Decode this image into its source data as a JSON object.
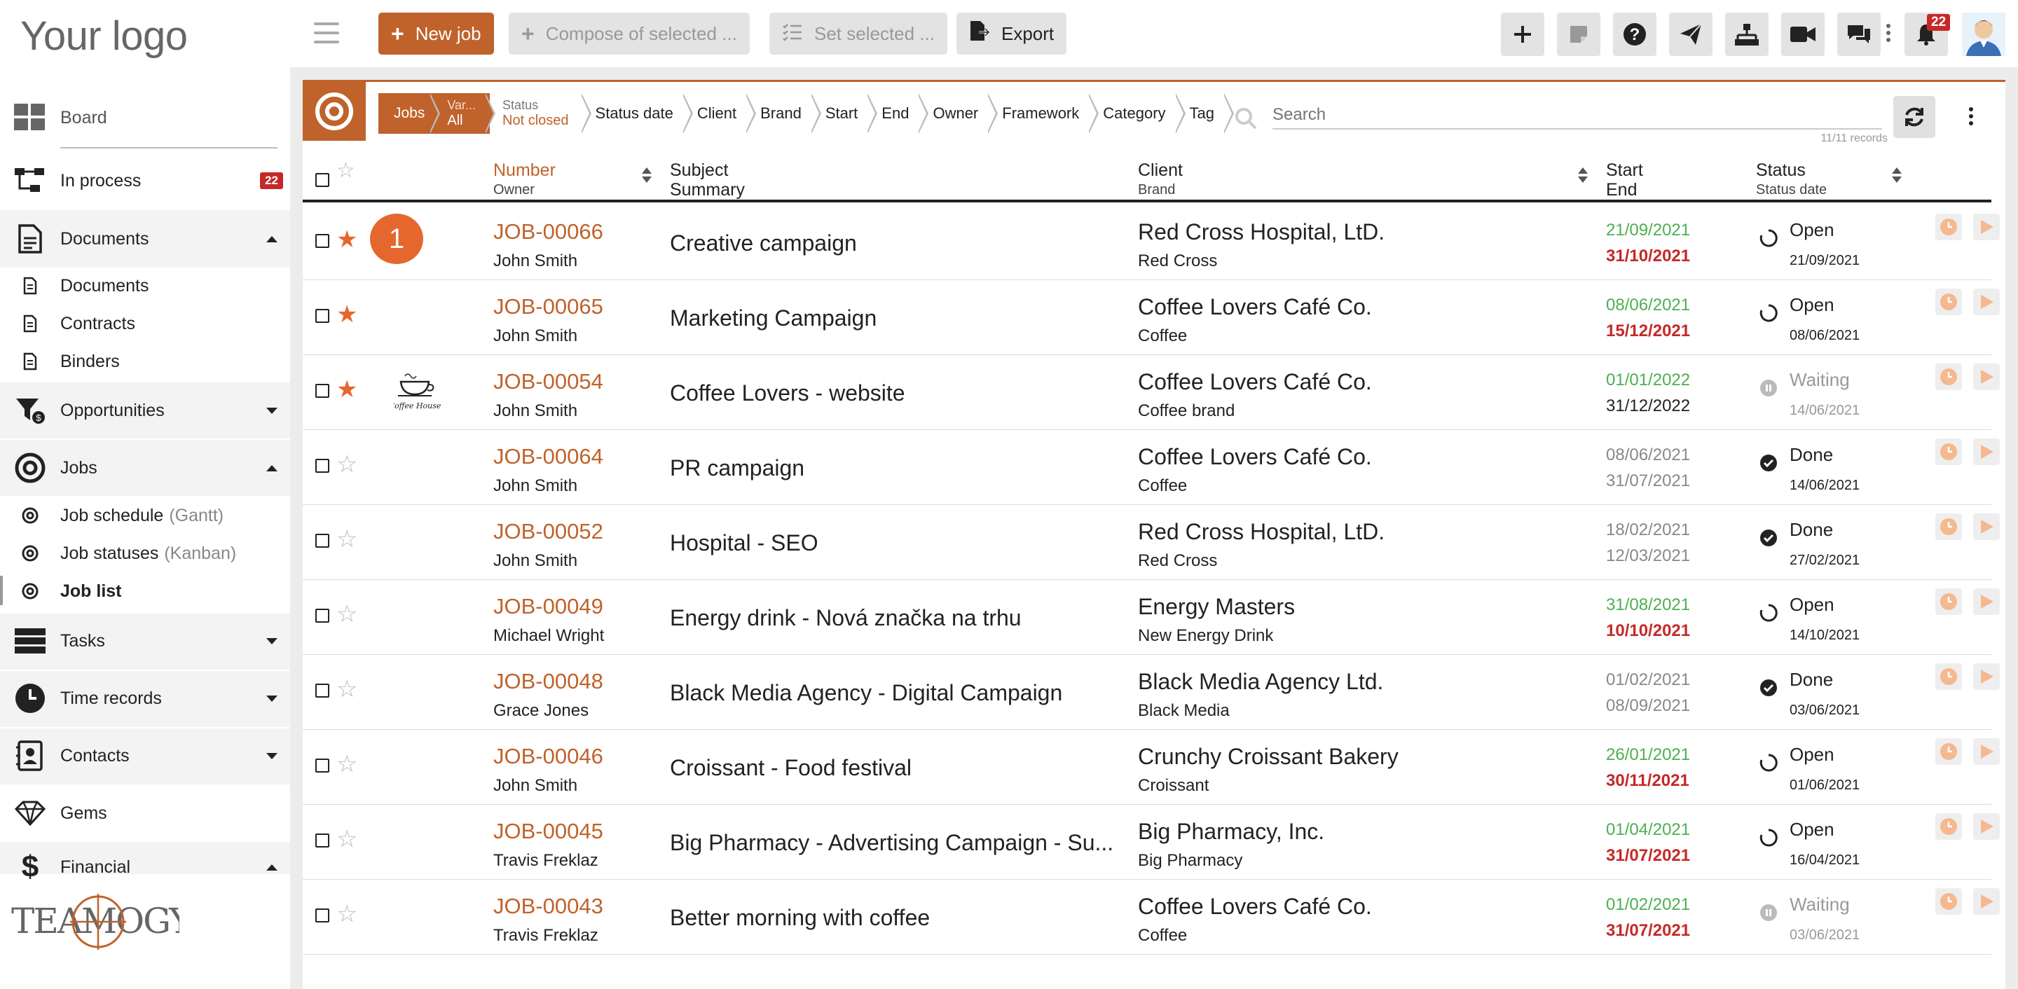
{
  "app": {
    "logo_text": "Your logo"
  },
  "sidebar": {
    "board": "Board",
    "in_process": "In process",
    "in_process_badge": "22",
    "documents": "Documents",
    "documents_items": [
      "Documents",
      "Contracts",
      "Binders"
    ],
    "opportunities": "Opportunities",
    "jobs": "Jobs",
    "jobs_items": [
      {
        "label": "Job schedule",
        "hint": "(Gantt)"
      },
      {
        "label": "Job statuses",
        "hint": "(Kanban)"
      },
      {
        "label": "Job list",
        "hint": ""
      }
    ],
    "tasks": "Tasks",
    "time_records": "Time records",
    "contacts": "Contacts",
    "gems": "Gems",
    "financial": "Financial",
    "brand_logo": "TEAMOGY"
  },
  "toolbar": {
    "new_job": "New job",
    "compose": "Compose of selected ...",
    "set_selected": "Set selected ...",
    "export": "Export",
    "notifications_badge": "22"
  },
  "filters": {
    "tab_jobs": "Jobs",
    "var_label": "Var...",
    "var_value": "All",
    "status_label": "Status",
    "status_value": "Not closed",
    "crumbs": [
      "Status date",
      "Client",
      "Brand",
      "Start",
      "End",
      "Owner",
      "Framework",
      "Category",
      "Tag"
    ],
    "search_placeholder": "Search",
    "records": "11/11 records"
  },
  "table": {
    "headers": {
      "number": "Number",
      "owner": "Owner",
      "subject": "Subject",
      "summary": "Summary",
      "client": "Client",
      "brand": "Brand",
      "start": "Start",
      "end": "End",
      "status": "Status",
      "status_date": "Status date"
    },
    "rows": [
      {
        "number": "JOB-00066",
        "owner": "John Smith",
        "subject": "Creative campaign",
        "client": "Red Cross Hospital, LtD.",
        "brand": "Red Cross",
        "start": "21/09/2021",
        "end": "31/10/2021",
        "status": "Open",
        "status_date": "21/09/2021",
        "starred": true,
        "badge": "1"
      },
      {
        "number": "JOB-00065",
        "owner": "John Smith",
        "subject": "Marketing Campaign",
        "client": "Coffee Lovers Café Co.",
        "brand": "Coffee",
        "start": "08/06/2021",
        "end": "15/12/2021",
        "status": "Open",
        "status_date": "08/06/2021",
        "starred": true
      },
      {
        "number": "JOB-00054",
        "owner": "John Smith",
        "subject": "Coffee Lovers - website",
        "client": "Coffee Lovers Café Co.",
        "brand": "Coffee brand",
        "start": "01/01/2022",
        "end": "31/12/2022",
        "status": "Waiting",
        "status_date": "14/06/2021",
        "starred": true,
        "image_text": "Coffee House"
      },
      {
        "number": "JOB-00064",
        "owner": "John Smith",
        "subject": "PR campaign",
        "client": "Coffee Lovers Café Co.",
        "brand": "Coffee",
        "start": "08/06/2021",
        "end": "31/07/2021",
        "status": "Done",
        "status_date": "14/06/2021",
        "starred": false
      },
      {
        "number": "JOB-00052",
        "owner": "John Smith",
        "subject": "Hospital - SEO",
        "client": "Red Cross Hospital, LtD.",
        "brand": "Red Cross",
        "start": "18/02/2021",
        "end": "12/03/2021",
        "status": "Done",
        "status_date": "27/02/2021",
        "starred": false
      },
      {
        "number": "JOB-00049",
        "owner": "Michael Wright",
        "subject": "Energy drink - Nová značka na trhu",
        "client": "Energy Masters",
        "brand": "New Energy Drink",
        "start": "31/08/2021",
        "end": "10/10/2021",
        "status": "Open",
        "status_date": "14/10/2021",
        "starred": false
      },
      {
        "number": "JOB-00048",
        "owner": "Grace Jones",
        "subject": "Black Media Agency - Digital Campaign",
        "client": "Black Media Agency Ltd.",
        "brand": "Black Media",
        "start": "01/02/2021",
        "end": "08/09/2021",
        "status": "Done",
        "status_date": "03/06/2021",
        "starred": false
      },
      {
        "number": "JOB-00046",
        "owner": "John Smith",
        "subject": "Croissant - Food festival",
        "client": "Crunchy Croissant Bakery",
        "brand": "Croissant",
        "start": "26/01/2021",
        "end": "30/11/2021",
        "status": "Open",
        "status_date": "01/06/2021",
        "starred": false
      },
      {
        "number": "JOB-00045",
        "owner": "Travis Freklaz",
        "subject": "Big Pharmacy - Advertising Campaign - Su...",
        "client": "Big Pharmacy, Inc.",
        "brand": "Big Pharmacy",
        "start": "01/04/2021",
        "end": "31/07/2021",
        "status": "Open",
        "status_date": "16/04/2021",
        "starred": false
      },
      {
        "number": "JOB-00043",
        "owner": "Travis Freklaz",
        "subject": "Better morning with coffee",
        "client": "Coffee Lovers Café Co.",
        "brand": "Coffee",
        "start": "01/02/2021",
        "end": "31/07/2021",
        "status": "Waiting",
        "status_date": "03/06/2021",
        "starred": false
      }
    ]
  },
  "colors": {
    "accent": "#c0622b",
    "star": "#e5672d",
    "start_green": "#4caf50",
    "end_red": "#c62828"
  }
}
